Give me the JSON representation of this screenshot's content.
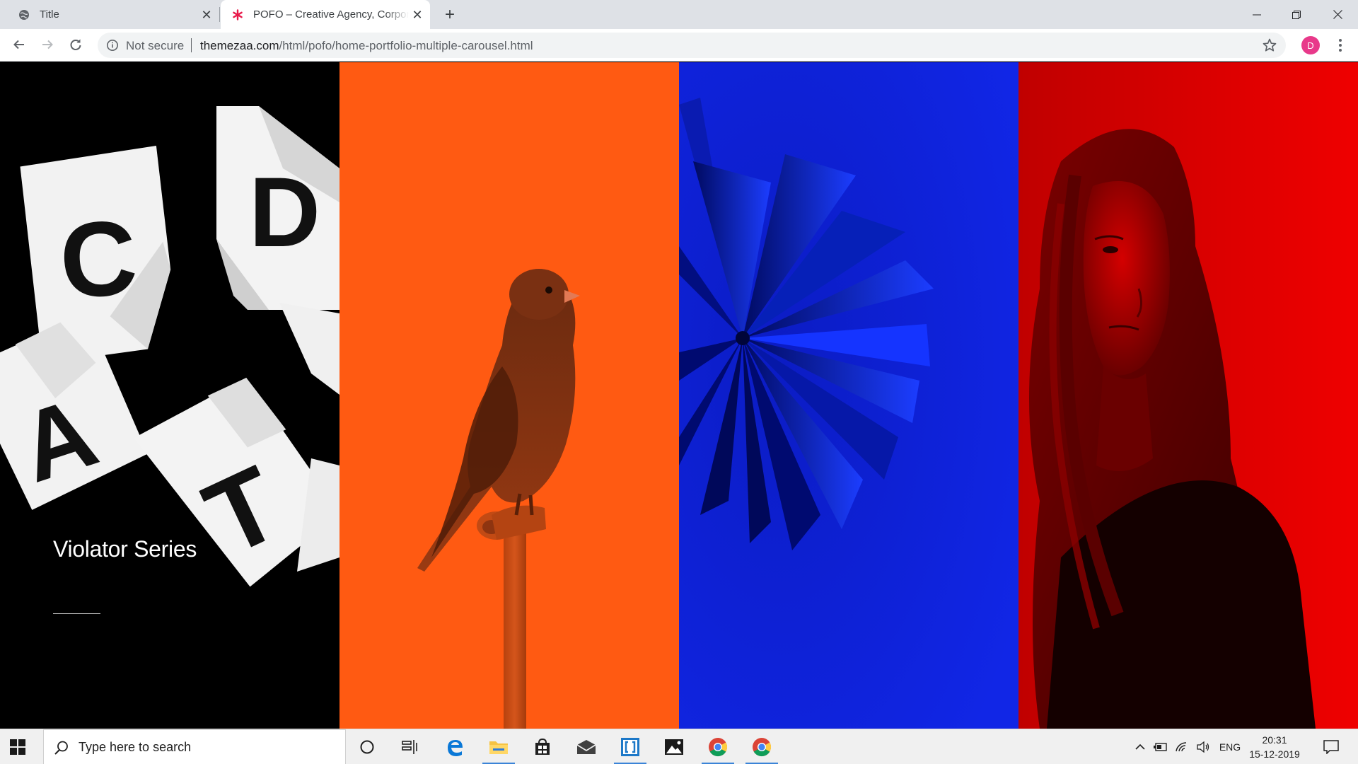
{
  "browser": {
    "tabs": [
      {
        "title": "Title",
        "favicon": "globe-icon",
        "active": false
      },
      {
        "title": "POFO – Creative Agency, Corporate",
        "favicon": "pofo-asterisk-icon",
        "active": true
      }
    ],
    "new_tab_label": "+",
    "security_label": "Not secure",
    "url_host": "themezaa.com",
    "url_path": "/html/pofo/home-portfolio-multiple-carousel.html",
    "profile_initial": "D",
    "colors": {
      "tab_strip": "#dee1e6",
      "profile": "#e8398a"
    }
  },
  "carousel": {
    "slides": [
      {
        "name": "violator-series",
        "title": "Violator Series",
        "background": "#000000",
        "letters": [
          "C",
          "D",
          "A",
          "T"
        ]
      },
      {
        "name": "canary-bird",
        "background": "#ff5a12"
      },
      {
        "name": "fanned-book",
        "background": "#0d1fd8"
      },
      {
        "name": "woman-portrait",
        "background": "#e60000"
      }
    ]
  },
  "taskbar": {
    "search_placeholder": "Type here to search",
    "apps": [
      "cortana-icon",
      "task-view-icon",
      "edge-icon",
      "file-explorer-icon",
      "store-icon",
      "mail-icon",
      "brackets-icon",
      "photos-icon",
      "chrome-icon",
      "chrome-icon"
    ],
    "language": "ENG",
    "time": "20:31",
    "date": "15-12-2019"
  }
}
